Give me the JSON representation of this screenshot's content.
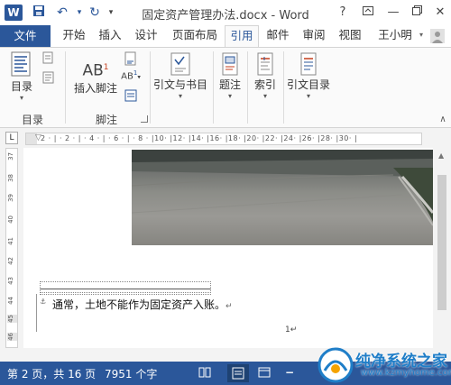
{
  "titlebar": {
    "app_logo": "W",
    "title": "固定资产管理办法.docx - Word",
    "help": "?",
    "qat_icons": [
      "save-icon",
      "undo-icon",
      "redo-icon"
    ],
    "qat_menu": "▾"
  },
  "tabs": [
    {
      "label": "文件"
    },
    {
      "label": "开始"
    },
    {
      "label": "插入"
    },
    {
      "label": "设计"
    },
    {
      "label": "页面布局"
    },
    {
      "label": "引用"
    },
    {
      "label": "邮件"
    },
    {
      "label": "审阅"
    },
    {
      "label": "视图"
    }
  ],
  "user": "王小明",
  "ribbon": {
    "toc_button": "目录",
    "insert_footnote": "插入脚注",
    "ab_label": "AB",
    "ab_sup": "1",
    "citations_button": "引文与书目",
    "caption_button": "题注",
    "index_button": "索引",
    "toa_button": "引文目录",
    "group_toc": "目录",
    "group_footnotes": "脚注"
  },
  "ruler": {
    "corner": "L",
    "ticks": "2 · | · 2 · | · 4 · | · 6 · | · 8 · |10· |12· |14· |16· |18· |20· |22· |24· |26· |28· |30· |",
    "v_ticks": [
      "37",
      "38",
      "39",
      "40",
      "41",
      "42",
      "43",
      "44",
      "45",
      "46"
    ]
  },
  "document": {
    "body_text": "通常，土地不能作为固定资产入账。",
    "para_mark": "↵",
    "page_number": "1↵"
  },
  "status": {
    "page": "第 2 页，共 16 页",
    "words": "7951 个字",
    "zoom_minus": "−"
  },
  "watermark": {
    "name": "纯净系统之家",
    "url": "www.kzmyhome.com"
  },
  "colors": {
    "accent": "#2b579a"
  }
}
